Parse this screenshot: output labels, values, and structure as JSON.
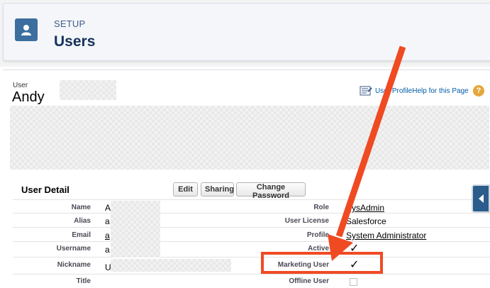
{
  "header": {
    "section": "SETUP",
    "title": "Users"
  },
  "user": {
    "type_label": "User",
    "name": "Andy"
  },
  "help": {
    "link_text": "User ProfileHelp for this Page",
    "q_icon": "?"
  },
  "detail": {
    "title": "User Detail",
    "buttons": {
      "edit": "Edit",
      "sharing": "Sharing",
      "change_password": "Change Password"
    },
    "left_fields": [
      {
        "label": "Name",
        "value": "Andy"
      },
      {
        "label": "Alias",
        "value": "a"
      },
      {
        "label": "Email",
        "value": "a"
      },
      {
        "label": "Username",
        "value": "a"
      },
      {
        "label": "Nickname",
        "value": "U"
      },
      {
        "label": "Title",
        "value": ""
      }
    ],
    "right_fields": [
      {
        "label": "Role",
        "value": "SysAdmin"
      },
      {
        "label": "User License",
        "value": "Salesforce"
      },
      {
        "label": "Profile",
        "value": "System Administrator"
      },
      {
        "label": "Active",
        "value": "✓"
      },
      {
        "label": "Marketing User",
        "value": "✓"
      },
      {
        "label": "Offline User",
        "value": ""
      }
    ]
  },
  "annotation_color": "#f04a23",
  "icons": [
    "user-icon",
    "doc-icon",
    "help-icon",
    "collapse-icon"
  ]
}
